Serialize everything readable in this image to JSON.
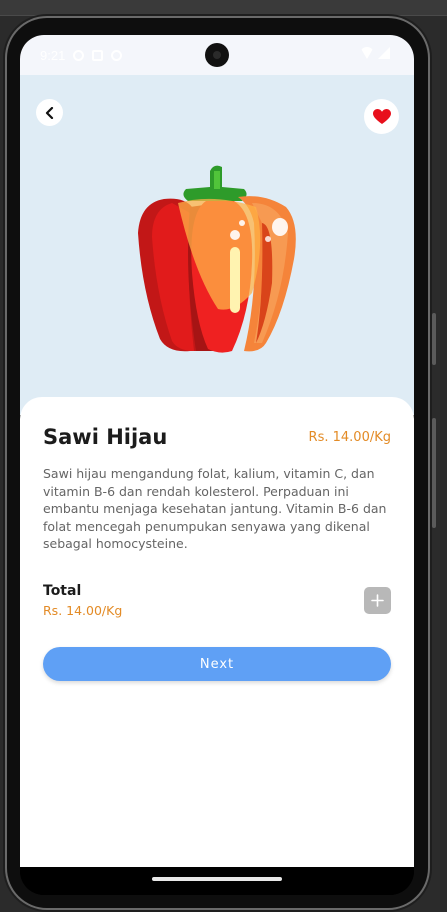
{
  "status": {
    "time": "9:21"
  },
  "product": {
    "name": "Sawi Hijau",
    "price": "Rs. 14.00/Kg",
    "description": "Sawi hijau mengandung folat, kalium, vitamin C, dan vitamin B-6 dan rendah kolesterol. Perpaduan ini embantu menjaga kesehatan jantung. Vitamin B-6 dan folat mencegah penumpukan senyawa yang dikenal sebagal homocysteine."
  },
  "total": {
    "label": "Total",
    "price": "Rs. 14.00/Kg"
  },
  "actions": {
    "next_label": "Next"
  },
  "icons": {
    "back": "chevron-left-icon",
    "favorite": "heart-icon",
    "add": "plus-icon"
  },
  "colors": {
    "hero_bg": "#dfecf5",
    "accent_price": "#e38b26",
    "button": "#5fa0f5",
    "heart": "#e8101c"
  }
}
